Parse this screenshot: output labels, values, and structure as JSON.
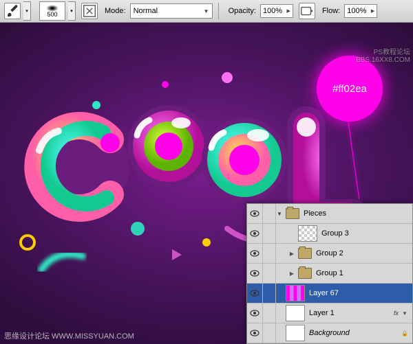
{
  "toolbar": {
    "brush_size": "500",
    "mode_label": "Mode:",
    "mode_value": "Normal",
    "opacity_label": "Opacity:",
    "opacity_value": "100%",
    "flow_label": "Flow:",
    "flow_value": "100%"
  },
  "callout": {
    "color_hex": "#ff02ea"
  },
  "watermarks": {
    "top_right": "PS教程论坛\nBBS.16XX8.COM",
    "bottom_left": "思缘设计论坛  WWW.MISSYUAN.COM"
  },
  "layers": {
    "items": [
      {
        "indent": 0,
        "twisty": "down",
        "type": "folder",
        "name": "Pieces",
        "selected": false,
        "fx": false
      },
      {
        "indent": 1,
        "twisty": "",
        "type": "thumb_checker",
        "name": "Group 3",
        "selected": false,
        "fx": false
      },
      {
        "indent": 1,
        "twisty": "right",
        "type": "folder",
        "name": "Group 2",
        "selected": false,
        "fx": false
      },
      {
        "indent": 1,
        "twisty": "right",
        "type": "folder",
        "name": "Group 1",
        "selected": false,
        "fx": false
      },
      {
        "indent": 0,
        "twisty": "",
        "type": "thumb_sel",
        "name": "Layer 67",
        "selected": true,
        "fx": false
      },
      {
        "indent": 0,
        "twisty": "",
        "type": "thumb_white",
        "name": "Layer 1",
        "selected": false,
        "fx": true
      },
      {
        "indent": 0,
        "twisty": "",
        "type": "thumb_white",
        "name": "Background",
        "selected": false,
        "italic": true,
        "lock": true
      }
    ]
  }
}
